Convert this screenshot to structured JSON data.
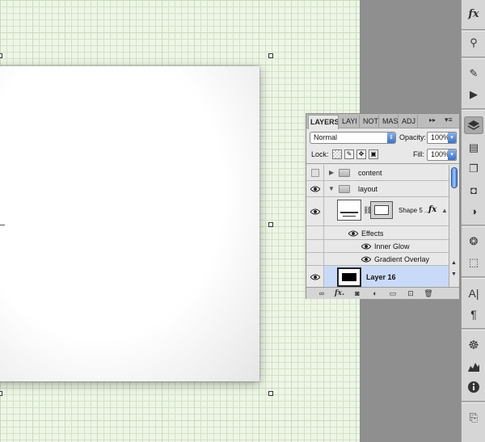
{
  "layers_panel": {
    "tabs": [
      "LAYERS",
      "LAYI",
      "NOT",
      "MAS",
      "ADJ"
    ],
    "blend_mode": "Normal",
    "opacity_label": "Opacity:",
    "opacity_value": "100%",
    "lock_label": "Lock:",
    "fill_label": "Fill:",
    "fill_value": "100%",
    "layers": [
      {
        "name": "content",
        "type": "group",
        "expanded": false,
        "visible": false
      },
      {
        "name": "layout",
        "type": "group",
        "expanded": true,
        "visible": true
      },
      {
        "name": "Shape 5 ...",
        "type": "shape",
        "visible": true
      },
      {
        "name": "Effects",
        "type": "effects-header"
      },
      {
        "name": "Inner Glow",
        "type": "effect"
      },
      {
        "name": "Gradient Overlay",
        "type": "effect"
      },
      {
        "name": "Layer 16",
        "type": "layer",
        "visible": true,
        "selected": true
      }
    ]
  },
  "icons": {
    "dock": [
      "fx-icon",
      "puppet-icon",
      "brush-presets-icon",
      "actions-play-icon",
      "layers-icon",
      "channels-icon",
      "paths-icon",
      "mask-icon",
      "adjustments-icon",
      "styles-icon",
      "transform-icon",
      "character-icon",
      "paragraph-icon",
      "navigator-icon",
      "histogram-icon",
      "info-icon",
      "tool-presets-icon"
    ]
  },
  "colors": {
    "selected_row": "#c9daf8",
    "accent_blue": "#3b73c9"
  }
}
